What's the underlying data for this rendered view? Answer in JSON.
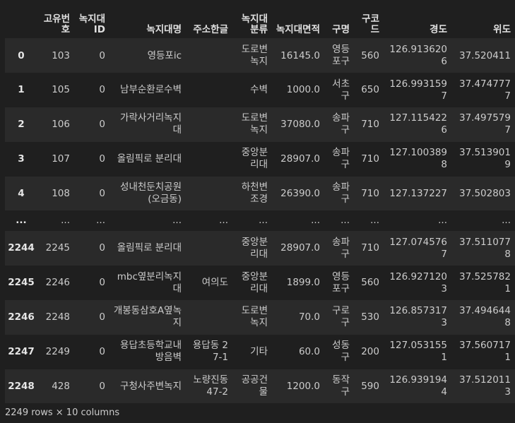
{
  "columns": [
    "",
    "고유번호",
    "녹지대ID",
    "녹지대명",
    "주소한글",
    "녹지대분류",
    "녹지대면적",
    "구명",
    "구코드",
    "경도",
    "위도"
  ],
  "rows": [
    [
      "0",
      "103",
      "0",
      "영등포ic",
      "",
      "도로변녹지",
      "16145.0",
      "영등포구",
      "560",
      "126.9136206",
      "37.520411"
    ],
    [
      "1",
      "105",
      "0",
      "남부순환로수벽",
      "",
      "수벽",
      "1000.0",
      "서초구",
      "650",
      "126.9931597",
      "37.4747777"
    ],
    [
      "2",
      "106",
      "0",
      "가락사거리녹지대",
      "",
      "도로변녹지",
      "37080.0",
      "송파구",
      "710",
      "127.1154226",
      "37.4975797"
    ],
    [
      "3",
      "107",
      "0",
      "올림픽로 분리대",
      "",
      "중앙분리대",
      "28907.0",
      "송파구",
      "710",
      "127.1003898",
      "37.5139019"
    ],
    [
      "4",
      "108",
      "0",
      "성내천둔치공원(오금동)",
      "",
      "하천변조경",
      "26390.0",
      "송파구",
      "710",
      "127.137227",
      "37.502803"
    ],
    [
      "...",
      "...",
      "...",
      "...",
      "...",
      "...",
      "...",
      "...",
      "...",
      "...",
      "..."
    ],
    [
      "2244",
      "2245",
      "0",
      "올림픽로 분리대",
      "",
      "중앙분리대",
      "28907.0",
      "송파구",
      "710",
      "127.0745767",
      "37.5110778"
    ],
    [
      "2245",
      "2246",
      "0",
      "mbc옆분리녹지대",
      "여의도",
      "중앙분리대",
      "1899.0",
      "영등포구",
      "560",
      "126.9271203",
      "37.5257821"
    ],
    [
      "2246",
      "2248",
      "0",
      "개봉동삼호A옆녹지",
      "",
      "도로변녹지",
      "70.0",
      "구로구",
      "530",
      "126.8573173",
      "37.4946448"
    ],
    [
      "2247",
      "2249",
      "0",
      "용답초등학교내 방음벽",
      "용답동 27-1",
      "기타",
      "60.0",
      "성동구",
      "200",
      "127.0531551",
      "37.5607171"
    ],
    [
      "2248",
      "428",
      "0",
      "구청사주변녹지",
      "노량진동 47-2",
      "공공건물",
      "1200.0",
      "동작구",
      "590",
      "126.9391944",
      "37.5120113"
    ]
  ],
  "footer": "2249 rows × 10 columns"
}
